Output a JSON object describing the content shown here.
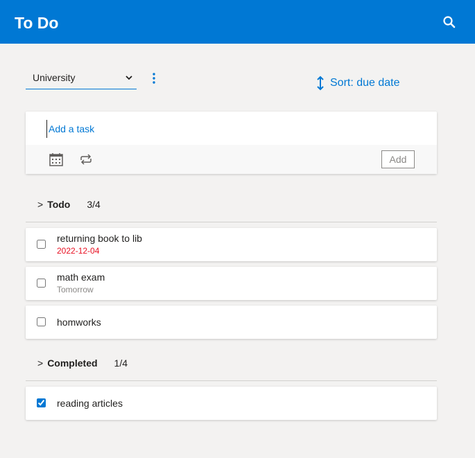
{
  "app": {
    "title": "To Do"
  },
  "toolbar": {
    "list_options": [
      "University"
    ],
    "selected_list": "University",
    "sort_label": "Sort: due date"
  },
  "add_task": {
    "placeholder": "Add a task",
    "add_label": "Add"
  },
  "sections": {
    "todo": {
      "title": "Todo",
      "count": "3/4",
      "chevron": ">"
    },
    "completed": {
      "title": "Completed",
      "count": "1/4",
      "chevron": ">"
    }
  },
  "tasks": {
    "todo": [
      {
        "title": "returning book to lib",
        "due": "2022-12-04",
        "due_color": "#e81123",
        "checked": false
      },
      {
        "title": "math exam",
        "due": "Tomorrow",
        "due_color": "#8a8886",
        "checked": false
      },
      {
        "title": "homworks",
        "due": "",
        "checked": false
      }
    ],
    "completed": [
      {
        "title": "reading articles",
        "due": "",
        "checked": true
      }
    ]
  },
  "colors": {
    "accent": "#0078d4",
    "background": "#f3f2f1",
    "overdue": "#e81123"
  },
  "icons": {
    "search": "search-icon",
    "more": "more-vertical-icon",
    "sort": "sort-arrows-icon",
    "calendar": "calendar-icon",
    "repeat": "repeat-icon"
  }
}
